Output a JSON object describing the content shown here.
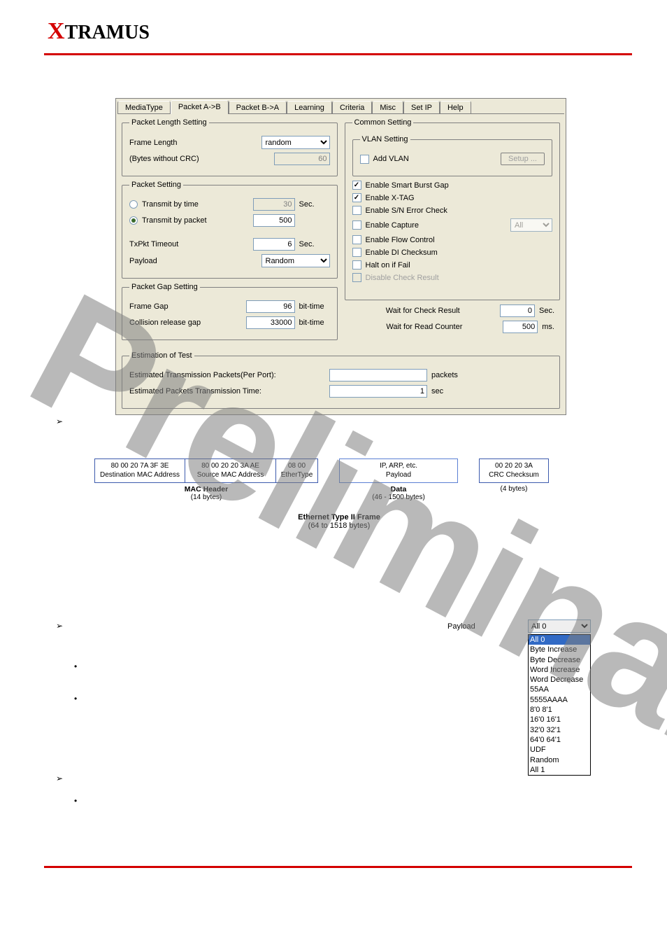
{
  "brand": "XTRAMUS",
  "watermark": "Preliminary",
  "dialog": {
    "tabs": [
      "MediaType",
      "Packet A->B",
      "Packet B->A",
      "Learning",
      "Criteria",
      "Misc",
      "Set IP",
      "Help"
    ],
    "active_tab": 1,
    "pls": {
      "legend": "Packet Length Setting",
      "frame_length_lbl": "Frame Length",
      "frame_length_val": "random",
      "bytes_lbl": "(Bytes without CRC)",
      "bytes_val": "60"
    },
    "ps": {
      "legend": "Packet Setting",
      "by_time_lbl": "Transmit by time",
      "by_time_val": "30",
      "by_time_unit": "Sec.",
      "by_pkt_lbl": "Transmit by packet",
      "by_pkt_val": "500",
      "timeout_lbl": "TxPkt Timeout",
      "timeout_val": "6",
      "timeout_unit": "Sec.",
      "payload_lbl": "Payload",
      "payload_val": "Random"
    },
    "pgs": {
      "legend": "Packet Gap Setting",
      "frame_gap_lbl": "Frame Gap",
      "frame_gap_val": "96",
      "frame_gap_unit": "bit-time",
      "crg_lbl": "Collision release gap",
      "crg_val": "33000",
      "crg_unit": "bit-time"
    },
    "cs": {
      "legend": "Common Setting",
      "vlan_legend": "VLAN Setting",
      "add_vlan": "Add VLAN",
      "setup_btn": "Setup ...",
      "opts": [
        {
          "label": "Enable Smart Burst Gap",
          "checked": true
        },
        {
          "label": "Enable X-TAG",
          "checked": true
        },
        {
          "label": "Enable S/N Error Check",
          "checked": false
        },
        {
          "label": "Enable Capture",
          "checked": false
        },
        {
          "label": "Enable Flow Control",
          "checked": false
        },
        {
          "label": "Enable DI Checksum",
          "checked": false
        },
        {
          "label": "Halt on if Fail",
          "checked": false
        },
        {
          "label": "Disable Check Result",
          "checked": false,
          "disabled": true
        }
      ],
      "capture_sel": "All",
      "wait_check_lbl": "Wait for Check Result",
      "wait_check_val": "0",
      "wait_check_unit": "Sec.",
      "wait_read_lbl": "Wait for Read Counter",
      "wait_read_val": "500",
      "wait_read_unit": "ms."
    },
    "est": {
      "legend": "Estimation of Test",
      "pkts_lbl": "Estimated Transmission Packets(Per Port):",
      "pkts_val": "",
      "pkts_unit": "packets",
      "time_lbl": "Estimated Packets Transmission Time:",
      "time_val": "1",
      "time_unit": "sec"
    }
  },
  "frame": {
    "dmac": "80 00 20 7A 3F 3E",
    "dmac_lbl": "Destination MAC Address",
    "smac": "80 00 20 20 3A AE",
    "smac_lbl": "Source MAC Address",
    "etype": "08 00",
    "etype_lbl": "EtherType",
    "payload_top": "IP, ARP, etc.",
    "payload_lbl": "Payload",
    "crc": "00 20 20 3A",
    "crc_lbl": "CRC Checksum",
    "mac_hdr": "MAC Header",
    "mac_hdr_sz": "(14 bytes)",
    "data_lbl": "Data",
    "data_sz": "(46 - 1500 bytes)",
    "crc_sz": "(4 bytes)",
    "overall": "Ethernet Type II Frame",
    "overall_sz": "(64 to 1518 bytes)"
  },
  "payload_shot": {
    "label": "Payload",
    "current": "All 0",
    "options": [
      "All 0",
      "Byte Increase",
      "Byte Decrease",
      "Word Increase",
      "Word Decrease",
      "55AA",
      "5555AAAA",
      "8'0 8'1",
      "16'0 16'1",
      "32'0 32'1",
      "64'0 64'1",
      "UDF",
      "Random",
      "All 1"
    ]
  }
}
